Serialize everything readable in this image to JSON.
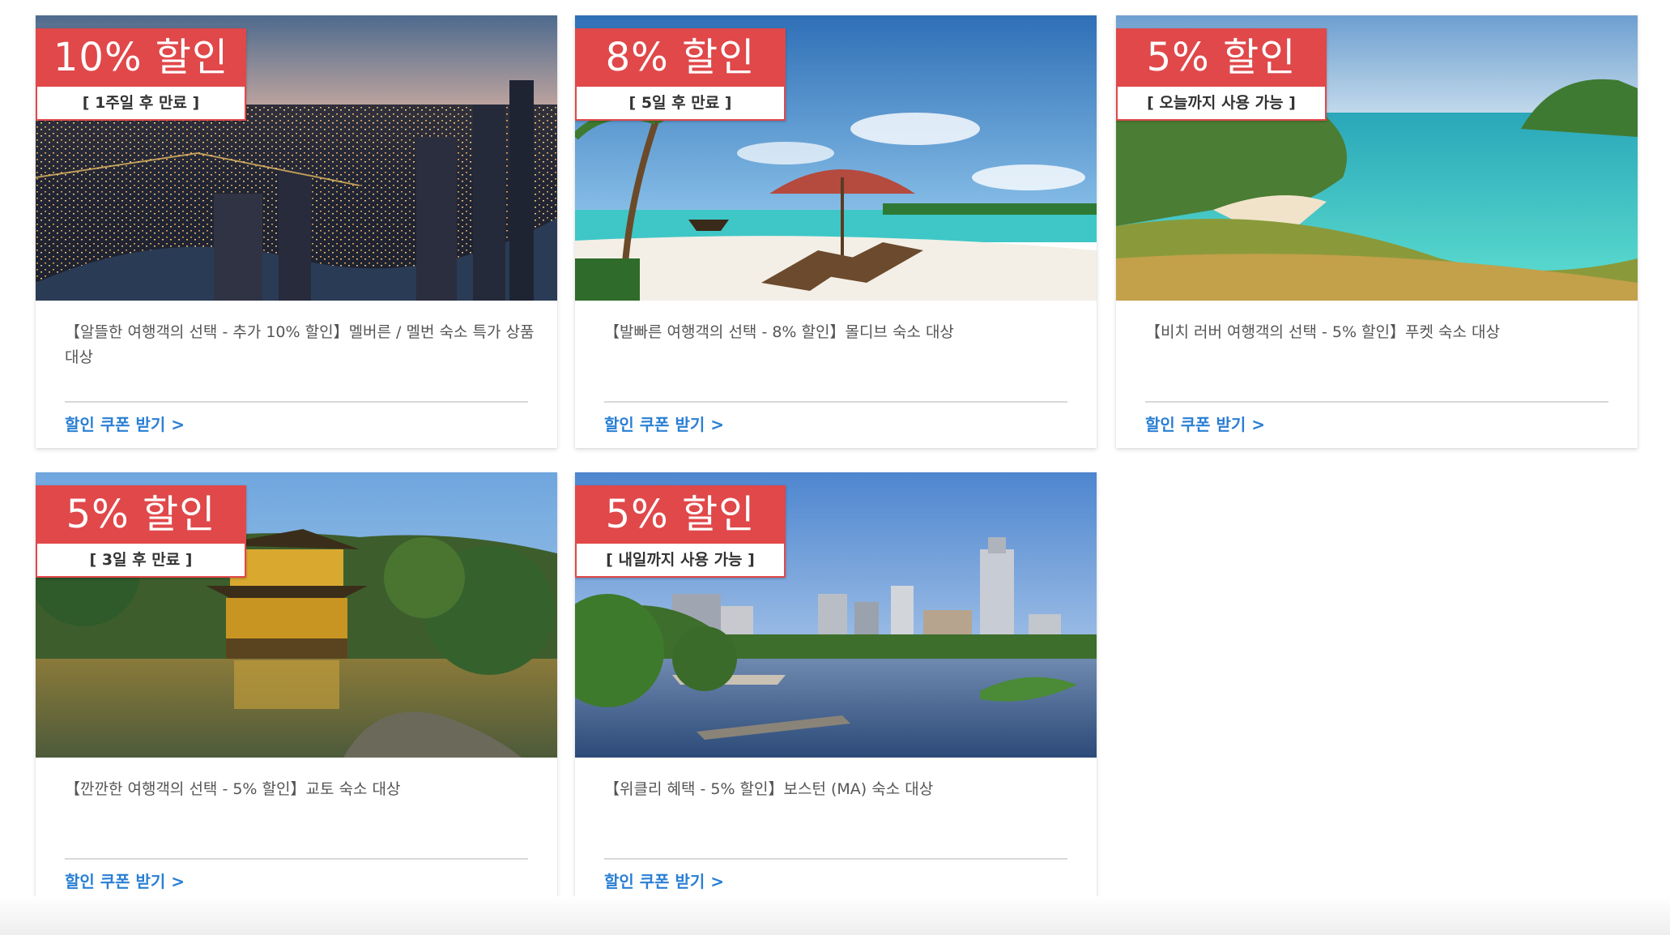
{
  "cards": [
    {
      "discount": "10% 할인",
      "expiry": "[ 1주일 후 만료 ]",
      "title": "【알뜰한 여행객의 선택 - 추가 10% 할인】멜버른 / 멜번 숙소 특가 상품 대상",
      "link": "할인 쿠폰 받기 >",
      "image": "city-night-skyline"
    },
    {
      "discount": "8% 할인",
      "expiry": "[ 5일 후 만료 ]",
      "title": "【발빠른 여행객의 선택 - 8% 할인】몰디브 숙소 대상",
      "link": "할인 쿠폰 받기 >",
      "image": "beach-umbrella-loungers"
    },
    {
      "discount": "5% 할인",
      "expiry": "[ 오늘까지 사용 가능 ]",
      "title": "【비치 러버 여행객의 선택 - 5% 할인】푸켓 숙소 대상",
      "link": "할인 쿠폰 받기 >",
      "image": "tropical-bay"
    },
    {
      "discount": "5% 할인",
      "expiry": "[ 3일 후 만료 ]",
      "title": "【깐깐한 여행객의 선택 - 5% 할인】교토 숙소 대상",
      "link": "할인 쿠폰 받기 >",
      "image": "golden-pavilion"
    },
    {
      "discount": "5% 할인",
      "expiry": "[ 내일까지 사용 가능 ]",
      "title": "【위클리 혜택 - 5% 할인】보스턴 (MA) 숙소 대상",
      "link": "할인 쿠폰 받기 >",
      "image": "boston-river-skyline"
    }
  ],
  "colors": {
    "badge": "#e0484a",
    "link": "#2a7fd4"
  }
}
